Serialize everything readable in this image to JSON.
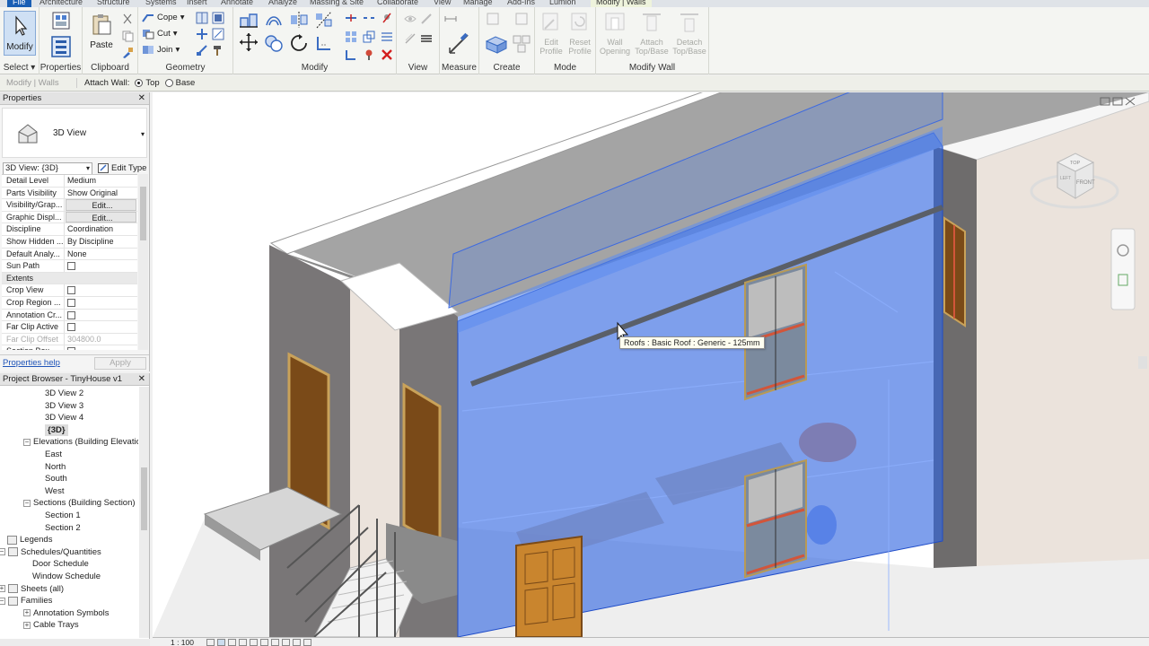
{
  "ribbon_tabs": [
    "File",
    "Architecture",
    "Structure",
    "Systems",
    "Insert",
    "Annotate",
    "Analyze",
    "Massing & Site",
    "Collaborate",
    "View",
    "Manage",
    "Add-Ins",
    "Lumion",
    "Modify | Walls"
  ],
  "ribbon": {
    "select": {
      "modify_label": "Modify",
      "panel_label": "Select"
    },
    "properties": {
      "panel_label": "Properties"
    },
    "clipboard": {
      "paste_label": "Paste",
      "panel_label": "Clipboard"
    },
    "geometry": {
      "cope_label": "Cope",
      "cut_label": "Cut",
      "join_label": "Join",
      "panel_label": "Geometry"
    },
    "modify": {
      "panel_label": "Modify"
    },
    "view": {
      "panel_label": "View"
    },
    "measure": {
      "panel_label": "Measure"
    },
    "create": {
      "panel_label": "Create"
    },
    "mode": {
      "edit_profile": "Edit Profile",
      "reset_profile": "Reset Profile",
      "panel_label": "Mode"
    },
    "modify_walls": {
      "wall_opening": "Wall Opening",
      "attach": "Attach Top/Base",
      "detach": "Detach Top/Base",
      "panel_label": "Modify Wall"
    }
  },
  "options_bar": {
    "context": "Modify | Walls",
    "label": "Attach Wall:",
    "options": [
      "Top",
      "Base"
    ],
    "selected": "Top"
  },
  "properties": {
    "title": "Properties",
    "type_name": "3D View",
    "instance_selector": "3D View: {3D}",
    "edit_type": "Edit Type",
    "rows": [
      {
        "k": "Detail Level",
        "v": "Medium"
      },
      {
        "k": "Parts Visibility",
        "v": "Show Original"
      },
      {
        "k": "Visibility/Grap...",
        "v": "Edit...",
        "btn": true
      },
      {
        "k": "Graphic Displ...",
        "v": "Edit...",
        "btn": true
      },
      {
        "k": "Discipline",
        "v": "Coordination"
      },
      {
        "k": "Show Hidden ...",
        "v": "By Discipline"
      },
      {
        "k": "Default Analy...",
        "v": "None"
      },
      {
        "k": "Sun Path",
        "cb": true
      }
    ],
    "group_extents": "Extents",
    "extents_rows": [
      {
        "k": "Crop View",
        "cb": true
      },
      {
        "k": "Crop Region ...",
        "cb": true
      },
      {
        "k": "Annotation Cr...",
        "cb": true
      },
      {
        "k": "Far Clip Active",
        "cb": true
      },
      {
        "k": "Far Clip Offset",
        "v": "304800.0",
        "grey": true
      },
      {
        "k": "Section Box",
        "cb": true
      }
    ],
    "help": "Properties help",
    "apply": "Apply"
  },
  "browser": {
    "title": "Project Browser - TinyHouse v1",
    "items": [
      {
        "label": "3D View 2",
        "indent": 3
      },
      {
        "label": "3D View 3",
        "indent": 3
      },
      {
        "label": "3D View 4",
        "indent": 3
      },
      {
        "label": "{3D}",
        "indent": 3,
        "selected": true
      },
      {
        "label": "Elevations (Building Elevation",
        "indent": 2,
        "exp": "−"
      },
      {
        "label": "East",
        "indent": 3
      },
      {
        "label": "North",
        "indent": 3
      },
      {
        "label": "South",
        "indent": 3
      },
      {
        "label": "West",
        "indent": 3
      },
      {
        "label": "Sections (Building Section)",
        "indent": 2,
        "exp": "−"
      },
      {
        "label": "Section 1",
        "indent": 3
      },
      {
        "label": "Section 2",
        "indent": 3
      },
      {
        "label": "Legends",
        "indent": 1,
        "icon": true
      },
      {
        "label": "Schedules/Quantities",
        "indent": 1,
        "exp": "−",
        "icon": true
      },
      {
        "label": "Door Schedule",
        "indent": 2
      },
      {
        "label": "Window Schedule",
        "indent": 2
      },
      {
        "label": "Sheets (all)",
        "indent": 1,
        "exp": "+",
        "icon": true
      },
      {
        "label": "Families",
        "indent": 1,
        "exp": "−",
        "icon": true
      },
      {
        "label": "Annotation Symbols",
        "indent": 2,
        "exp": "+"
      },
      {
        "label": "Cable Trays",
        "indent": 2,
        "exp": "+"
      }
    ]
  },
  "viewport": {
    "tooltip": "Roofs : Basic Roof : Generic - 125mm",
    "scale": "1 : 100",
    "viewcube_top": "TOP",
    "viewcube_front": "FRONT",
    "viewcube_left": "LEFT"
  },
  "colors": {
    "selection_blue": "#2f64e0",
    "ribbon_bg": "#f4f5f2",
    "file_tab": "#1a5fb4"
  }
}
